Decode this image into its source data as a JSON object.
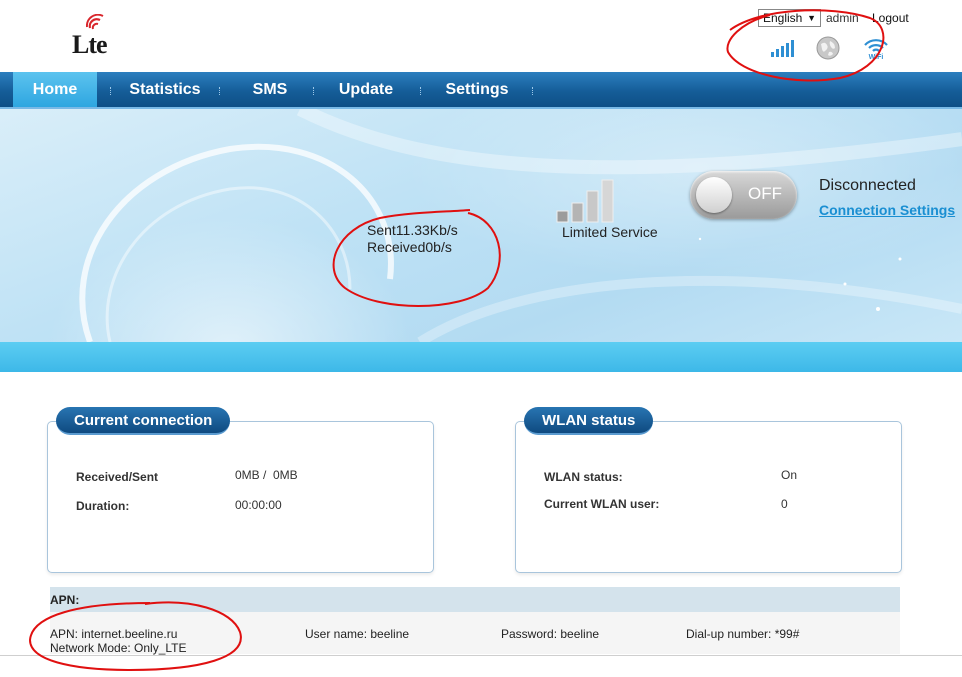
{
  "header": {
    "logo_text": "Lte",
    "language": "English",
    "user": "admin",
    "logout_label": "Logout"
  },
  "nav": {
    "items": [
      {
        "label": "Home",
        "active": true
      },
      {
        "label": "Statistics"
      },
      {
        "label": "SMS"
      },
      {
        "label": "Update"
      },
      {
        "label": "Settings"
      }
    ]
  },
  "banner": {
    "sent_rate": "Sent11.33Kb/s",
    "received_rate": "Received0b/s",
    "service_status": "Limited Service",
    "toggle_label": "OFF",
    "connection_status": "Disconnected",
    "connection_settings_label": "Connection Settings"
  },
  "current_connection": {
    "title": "Current connection",
    "rows": [
      {
        "label": "Received/Sent",
        "value": "0MB /  0MB"
      },
      {
        "label": "Duration:",
        "value": "00:00:00"
      }
    ]
  },
  "wlan": {
    "title": "WLAN status",
    "rows": [
      {
        "label": "WLAN status:",
        "value": "On"
      },
      {
        "label": "Current WLAN user:",
        "value": "0"
      }
    ]
  },
  "apn": {
    "header": "APN:",
    "apn_value": "APN: internet.beeline.ru",
    "network_mode": "Network Mode: Only_LTE",
    "user_name": "User name: beeline",
    "password": "Password: beeline",
    "dialup": "Dial-up number: *99#"
  },
  "icons": {
    "signal": "signal-bars-icon",
    "globe": "globe-icon",
    "wifi": "wifi-icon"
  },
  "colors": {
    "nav_blue": "#155d98",
    "active_tab": "#2ea6e0",
    "link_blue": "#1a8fd2",
    "annotation_red": "#e01010"
  }
}
